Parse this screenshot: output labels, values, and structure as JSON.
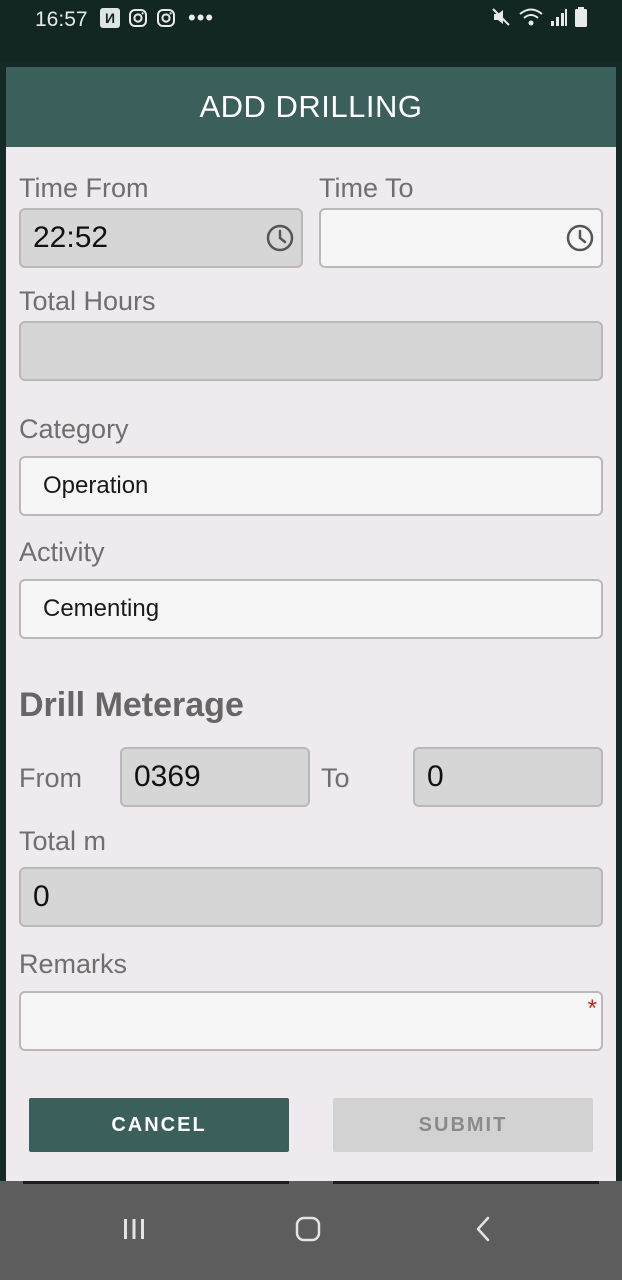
{
  "status_bar": {
    "time": "16:57",
    "notification_icons": [
      "notification-icon",
      "instagram-icon",
      "instagram-icon",
      "more-dots-icon"
    ],
    "more_dots": "•••",
    "app_box_glyph": "И"
  },
  "header": {
    "title": "ADD DRILLING"
  },
  "form": {
    "time_from": {
      "label": "Time From",
      "value": "22:52"
    },
    "time_to": {
      "label": "Time To",
      "value": ""
    },
    "total_hours": {
      "label": "Total Hours",
      "value": ""
    },
    "category": {
      "label": "Category",
      "value": "Operation"
    },
    "activity": {
      "label": "Activity",
      "value": "Cementing"
    },
    "drill_meterage": {
      "title": "Drill Meterage",
      "from_label": "From",
      "from_value": "0369",
      "to_label": "To",
      "to_value": "0"
    },
    "total_m": {
      "label": "Total m",
      "value": "0"
    },
    "remarks": {
      "label": "Remarks",
      "value": "",
      "required_mark": "*"
    }
  },
  "buttons": {
    "cancel": "CANCEL",
    "submit": "SUBMIT"
  },
  "colors": {
    "accent": "#3b5f5b",
    "background": "#efeaed",
    "required": "#cc2222"
  }
}
